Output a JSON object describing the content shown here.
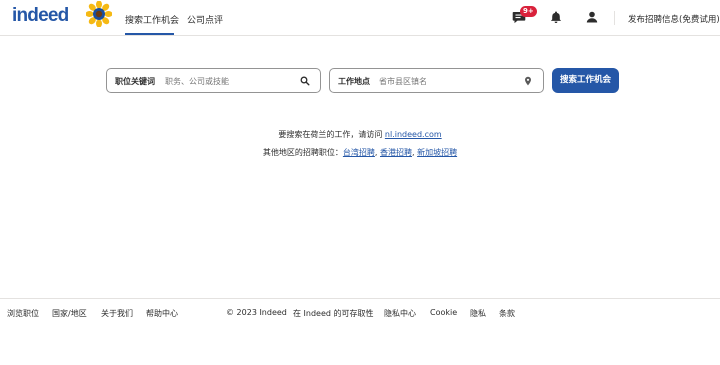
{
  "header": {
    "logo": "indeed",
    "nav": [
      {
        "label": "搜索工作机会",
        "active": true
      },
      {
        "label": "公司点评",
        "active": false
      }
    ],
    "messages_badge": "9+",
    "post_job": "发布招聘信息(免费试用)"
  },
  "search": {
    "what_label": "职位关键词",
    "what_placeholder": "职务、公司或技能",
    "where_label": "工作地点",
    "where_placeholder": "省市县区镇名",
    "button": "搜索工作机会"
  },
  "info": {
    "line1_prefix": "要搜索在荷兰的工作，请访问",
    "line1_link": "nl.indeed.com",
    "line2_prefix": "其他地区的招聘职位：",
    "line2_links": [
      "台湾招聘",
      "香港招聘",
      "新加坡招聘"
    ],
    "separator": ", "
  },
  "footer": {
    "links": [
      "浏览职位",
      "国家/地区",
      "关于我们",
      "帮助中心",
      "© 2023 Indeed",
      "在 Indeed 的可存取性",
      "隐私中心",
      "Cookie",
      "隐私",
      "条款"
    ]
  },
  "colors": {
    "brand": "#2557a7",
    "badge": "#d9213b",
    "text": "#2d2d2d"
  }
}
